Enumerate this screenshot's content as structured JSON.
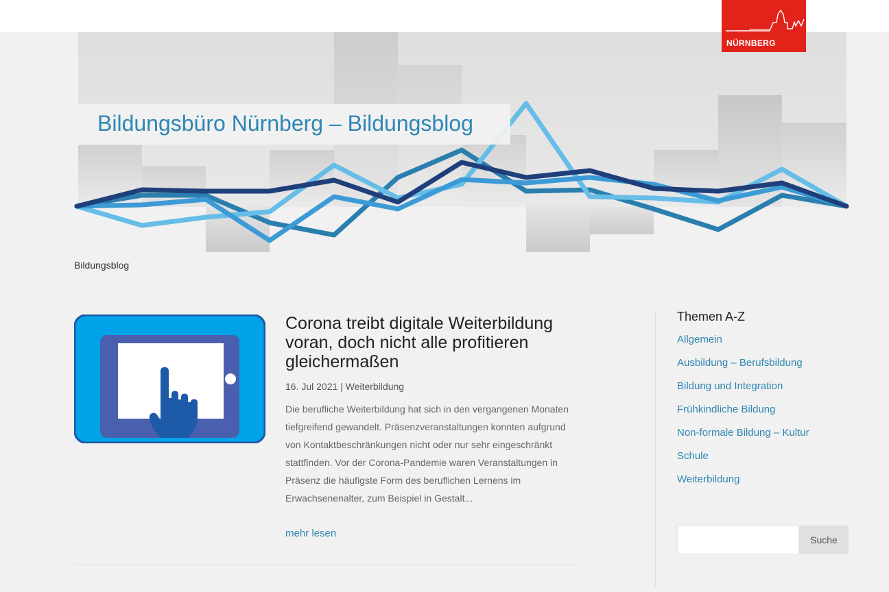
{
  "header": {
    "logo_text": "NÜRNBERG",
    "blog_title": "Bildungsbüro Nürnberg – Bildungsblog"
  },
  "colors": {
    "brand_red": "#e2231a",
    "link_blue": "#2e86b3",
    "line_dark": "#1f3f7a",
    "line_mid": "#2b7fae",
    "line_light": "#66bde8"
  },
  "breadcrumb": "Bildungsblog",
  "post": {
    "title": "Corona treibt digitale Weiterbildung voran, doch nicht alle profitieren gleichermaßen",
    "date": "16. Jul 2021",
    "separator": "|",
    "category": "Weiterbildung",
    "excerpt": "Die berufliche Weiterbildung hat sich in den vergangenen Monaten tiefgreifend gewandelt. Präsenzveranstaltungen konnten aufgrund von Kontaktbeschränkungen nicht oder nur sehr eingeschränkt stattfinden. Vor der Corona-Pandemie waren Veranstaltungen in Präsenz die häufigste Form des beruflichen Lernens im Erwachsenenalter, zum Beispiel in Gestalt...",
    "read_more": "mehr lesen",
    "image_icon": "tablet-touch-icon"
  },
  "sidebar": {
    "title": "Themen A-Z",
    "topics": [
      "Allgemein",
      "Ausbildung – Berufsbildung",
      "Bildung und Integration",
      "Frühkindliche Bildung",
      "Non-formale Bildung – Kultur",
      "Schule",
      "Weiterbildung"
    ],
    "search_placeholder": "",
    "search_button": "Suche"
  }
}
